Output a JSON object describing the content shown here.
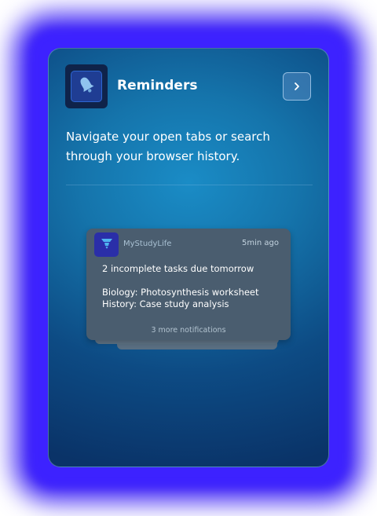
{
  "widget": {
    "title": "Reminders",
    "icon": "bell-icon",
    "next_button_icon": "chevron-right-icon",
    "description": "Navigate your open tabs or search through your browser history."
  },
  "notification": {
    "app_name": "MyStudyLife",
    "app_icon": "graduation-cap-icon",
    "time": "5min ago",
    "title": "2 incomplete tasks due tomorrow",
    "lines": [
      "Biology: Photosynthesis worksheet",
      "History: Case study analysis"
    ],
    "more": "3 more notifications"
  },
  "colors": {
    "glow": "#3a1ff5",
    "card_top": "#1a8cc6",
    "card_bottom": "#0a3368",
    "notification_bg": "#4a5d6f",
    "app_icon_bg": "#2a2ea8"
  }
}
